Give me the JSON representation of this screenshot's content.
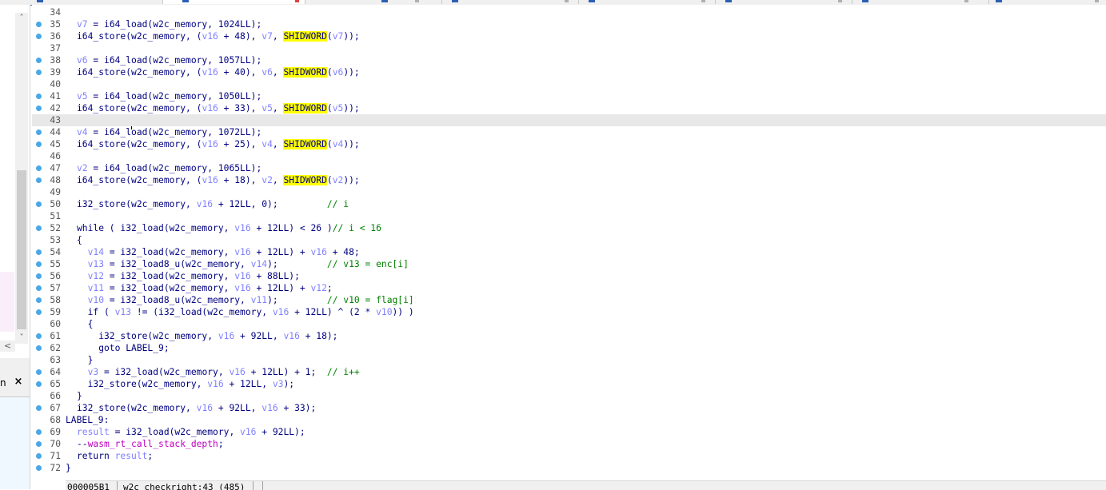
{
  "code_lines": [
    {
      "n": "34",
      "bp": false,
      "segs": []
    },
    {
      "n": "35",
      "bp": true,
      "segs": [
        {
          "t": "v",
          "s": "v7"
        },
        {
          "t": "p",
          "s": " = i64_load(w2c_memory, 1024LL);"
        }
      ]
    },
    {
      "n": "36",
      "bp": true,
      "segs": [
        {
          "t": "p",
          "s": "i64_store(w2c_memory, ("
        },
        {
          "t": "v",
          "s": "v16"
        },
        {
          "t": "p",
          "s": " + 48), "
        },
        {
          "t": "v",
          "s": "v7"
        },
        {
          "t": "p",
          "s": ", "
        },
        {
          "t": "h",
          "s": "SHIDWORD"
        },
        {
          "t": "p",
          "s": "("
        },
        {
          "t": "v",
          "s": "v7"
        },
        {
          "t": "p",
          "s": "));"
        }
      ]
    },
    {
      "n": "37",
      "bp": false,
      "segs": []
    },
    {
      "n": "38",
      "bp": true,
      "segs": [
        {
          "t": "v",
          "s": "v6"
        },
        {
          "t": "p",
          "s": " = i64_load(w2c_memory, 1057LL);"
        }
      ]
    },
    {
      "n": "39",
      "bp": true,
      "segs": [
        {
          "t": "p",
          "s": "i64_store(w2c_memory, ("
        },
        {
          "t": "v",
          "s": "v16"
        },
        {
          "t": "p",
          "s": " + 40), "
        },
        {
          "t": "v",
          "s": "v6"
        },
        {
          "t": "p",
          "s": ", "
        },
        {
          "t": "h",
          "s": "SHIDWORD"
        },
        {
          "t": "p",
          "s": "("
        },
        {
          "t": "v",
          "s": "v6"
        },
        {
          "t": "p",
          "s": "));"
        }
      ]
    },
    {
      "n": "40",
      "bp": false,
      "segs": []
    },
    {
      "n": "41",
      "bp": true,
      "segs": [
        {
          "t": "v",
          "s": "v5"
        },
        {
          "t": "p",
          "s": " = i64_load(w2c_memory, 1050LL);"
        }
      ]
    },
    {
      "n": "42",
      "bp": true,
      "segs": [
        {
          "t": "p",
          "s": "i64_store(w2c_memory, ("
        },
        {
          "t": "v",
          "s": "v16"
        },
        {
          "t": "p",
          "s": " + 33), "
        },
        {
          "t": "v",
          "s": "v5"
        },
        {
          "t": "p",
          "s": ", "
        },
        {
          "t": "h",
          "s": "SHIDWORD"
        },
        {
          "t": "p",
          "s": "("
        },
        {
          "t": "v",
          "s": "v5"
        },
        {
          "t": "p",
          "s": "));"
        }
      ]
    },
    {
      "n": "43",
      "bp": false,
      "current": true,
      "segs": []
    },
    {
      "n": "44",
      "bp": true,
      "segs": [
        {
          "t": "v",
          "s": "v4"
        },
        {
          "t": "p",
          "s": " = i64_load(w2c_memory, 1072LL);"
        }
      ]
    },
    {
      "n": "45",
      "bp": true,
      "segs": [
        {
          "t": "p",
          "s": "i64_store(w2c_memory, ("
        },
        {
          "t": "v",
          "s": "v16"
        },
        {
          "t": "p",
          "s": " + 25), "
        },
        {
          "t": "v",
          "s": "v4"
        },
        {
          "t": "p",
          "s": ", "
        },
        {
          "t": "h",
          "s": "SHIDWORD"
        },
        {
          "t": "p",
          "s": "("
        },
        {
          "t": "v",
          "s": "v4"
        },
        {
          "t": "p",
          "s": "));"
        }
      ]
    },
    {
      "n": "46",
      "bp": false,
      "segs": []
    },
    {
      "n": "47",
      "bp": true,
      "segs": [
        {
          "t": "v",
          "s": "v2"
        },
        {
          "t": "p",
          "s": " = i64_load(w2c_memory, 1065LL);"
        }
      ]
    },
    {
      "n": "48",
      "bp": true,
      "segs": [
        {
          "t": "p",
          "s": "i64_store(w2c_memory, ("
        },
        {
          "t": "v",
          "s": "v16"
        },
        {
          "t": "p",
          "s": " + 18), "
        },
        {
          "t": "v",
          "s": "v2"
        },
        {
          "t": "p",
          "s": ", "
        },
        {
          "t": "h",
          "s": "SHIDWORD"
        },
        {
          "t": "p",
          "s": "("
        },
        {
          "t": "v",
          "s": "v2"
        },
        {
          "t": "p",
          "s": "));"
        }
      ]
    },
    {
      "n": "49",
      "bp": false,
      "segs": []
    },
    {
      "n": "50",
      "bp": true,
      "segs": [
        {
          "t": "p",
          "s": "i32_store(w2c_memory, "
        },
        {
          "t": "v",
          "s": "v16"
        },
        {
          "t": "p",
          "s": " + 12LL, 0);         "
        },
        {
          "t": "c",
          "s": "// i"
        }
      ]
    },
    {
      "n": "51",
      "bp": false,
      "segs": []
    },
    {
      "n": "52",
      "bp": true,
      "segs": [
        {
          "t": "p",
          "s": "while ( i32_load(w2c_memory, "
        },
        {
          "t": "v",
          "s": "v16"
        },
        {
          "t": "p",
          "s": " + 12LL) < 26 )"
        },
        {
          "t": "c",
          "s": "// i < 16"
        }
      ]
    },
    {
      "n": "53",
      "bp": false,
      "segs": [
        {
          "t": "p",
          "s": "{"
        }
      ]
    },
    {
      "n": "54",
      "bp": true,
      "segs": [
        {
          "t": "p",
          "s": "  "
        },
        {
          "t": "v",
          "s": "v14"
        },
        {
          "t": "p",
          "s": " = i32_load(w2c_memory, "
        },
        {
          "t": "v",
          "s": "v16"
        },
        {
          "t": "p",
          "s": " + 12LL) + "
        },
        {
          "t": "v",
          "s": "v16"
        },
        {
          "t": "p",
          "s": " + 48;"
        }
      ]
    },
    {
      "n": "55",
      "bp": true,
      "segs": [
        {
          "t": "p",
          "s": "  "
        },
        {
          "t": "v",
          "s": "v13"
        },
        {
          "t": "p",
          "s": " = i32_load8_u(w2c_memory, "
        },
        {
          "t": "v",
          "s": "v14"
        },
        {
          "t": "p",
          "s": ");         "
        },
        {
          "t": "c",
          "s": "// v13 = enc[i]"
        }
      ]
    },
    {
      "n": "56",
      "bp": true,
      "segs": [
        {
          "t": "p",
          "s": "  "
        },
        {
          "t": "v",
          "s": "v12"
        },
        {
          "t": "p",
          "s": " = i32_load(w2c_memory, "
        },
        {
          "t": "v",
          "s": "v16"
        },
        {
          "t": "p",
          "s": " + 88LL);"
        }
      ]
    },
    {
      "n": "57",
      "bp": true,
      "segs": [
        {
          "t": "p",
          "s": "  "
        },
        {
          "t": "v",
          "s": "v11"
        },
        {
          "t": "p",
          "s": " = i32_load(w2c_memory, "
        },
        {
          "t": "v",
          "s": "v16"
        },
        {
          "t": "p",
          "s": " + 12LL) + "
        },
        {
          "t": "v",
          "s": "v12"
        },
        {
          "t": "p",
          "s": ";"
        }
      ]
    },
    {
      "n": "58",
      "bp": true,
      "segs": [
        {
          "t": "p",
          "s": "  "
        },
        {
          "t": "v",
          "s": "v10"
        },
        {
          "t": "p",
          "s": " = i32_load8_u(w2c_memory, "
        },
        {
          "t": "v",
          "s": "v11"
        },
        {
          "t": "p",
          "s": ");         "
        },
        {
          "t": "c",
          "s": "// v10 = flag[i]"
        }
      ]
    },
    {
      "n": "59",
      "bp": true,
      "segs": [
        {
          "t": "p",
          "s": "  if ( "
        },
        {
          "t": "v",
          "s": "v13"
        },
        {
          "t": "p",
          "s": " != (i32_load(w2c_memory, "
        },
        {
          "t": "v",
          "s": "v16"
        },
        {
          "t": "p",
          "s": " + 12LL) ^ (2 * "
        },
        {
          "t": "v",
          "s": "v10"
        },
        {
          "t": "p",
          "s": ")) )"
        }
      ]
    },
    {
      "n": "60",
      "bp": false,
      "segs": [
        {
          "t": "p",
          "s": "  {"
        }
      ]
    },
    {
      "n": "61",
      "bp": true,
      "segs": [
        {
          "t": "p",
          "s": "    i32_store(w2c_memory, "
        },
        {
          "t": "v",
          "s": "v16"
        },
        {
          "t": "p",
          "s": " + 92LL, "
        },
        {
          "t": "v",
          "s": "v16"
        },
        {
          "t": "p",
          "s": " + 18);"
        }
      ]
    },
    {
      "n": "62",
      "bp": true,
      "segs": [
        {
          "t": "p",
          "s": "    goto LABEL_9;"
        }
      ]
    },
    {
      "n": "63",
      "bp": false,
      "segs": [
        {
          "t": "p",
          "s": "  }"
        }
      ]
    },
    {
      "n": "64",
      "bp": true,
      "segs": [
        {
          "t": "p",
          "s": "  "
        },
        {
          "t": "v",
          "s": "v3"
        },
        {
          "t": "p",
          "s": " = i32_load(w2c_memory, "
        },
        {
          "t": "v",
          "s": "v16"
        },
        {
          "t": "p",
          "s": " + 12LL) + 1;  "
        },
        {
          "t": "c",
          "s": "// i++"
        }
      ]
    },
    {
      "n": "65",
      "bp": true,
      "segs": [
        {
          "t": "p",
          "s": "  i32_store(w2c_memory, "
        },
        {
          "t": "v",
          "s": "v16"
        },
        {
          "t": "p",
          "s": " + 12LL, "
        },
        {
          "t": "v",
          "s": "v3"
        },
        {
          "t": "p",
          "s": ");"
        }
      ]
    },
    {
      "n": "66",
      "bp": false,
      "segs": [
        {
          "t": "p",
          "s": "}"
        }
      ]
    },
    {
      "n": "67",
      "bp": true,
      "segs": [
        {
          "t": "p",
          "s": "i32_store(w2c_memory, "
        },
        {
          "t": "v",
          "s": "v16"
        },
        {
          "t": "p",
          "s": " + 92LL, "
        },
        {
          "t": "v",
          "s": "v16"
        },
        {
          "t": "p",
          "s": " + 33);"
        }
      ]
    },
    {
      "n": "68",
      "bp": false,
      "label": true,
      "segs": [
        {
          "t": "p",
          "s": "LABEL_9:"
        }
      ]
    },
    {
      "n": "69",
      "bp": true,
      "segs": [
        {
          "t": "v",
          "s": "result"
        },
        {
          "t": "p",
          "s": " = i32_load(w2c_memory, "
        },
        {
          "t": "v",
          "s": "v16"
        },
        {
          "t": "p",
          "s": " + 92LL);"
        }
      ]
    },
    {
      "n": "70",
      "bp": true,
      "segs": [
        {
          "t": "p",
          "s": "--"
        },
        {
          "t": "g",
          "s": "wasm_rt_call_stack_depth"
        },
        {
          "t": "p",
          "s": ";"
        }
      ]
    },
    {
      "n": "71",
      "bp": true,
      "segs": [
        {
          "t": "p",
          "s": "return "
        },
        {
          "t": "v",
          "s": "result"
        },
        {
          "t": "p",
          "s": ";"
        }
      ]
    },
    {
      "n": "72",
      "bp": true,
      "label": true,
      "segs": [
        {
          "t": "p",
          "s": "}"
        }
      ]
    }
  ],
  "status": {
    "address": "000005B1",
    "function": "w2c_checkright:43 (485)"
  },
  "left_panel": {
    "panel2_title": "n",
    "close_glyph": "×",
    "scroll_up": "˄",
    "scroll_down": "˅",
    "scroll_left": "<"
  },
  "colors": {
    "keyword_text": "#000080",
    "variable": "#8080ff",
    "comment": "#008000",
    "global": "#c000c0",
    "highlight": "#ffff00",
    "breakpoint": "#4aa8e6"
  }
}
